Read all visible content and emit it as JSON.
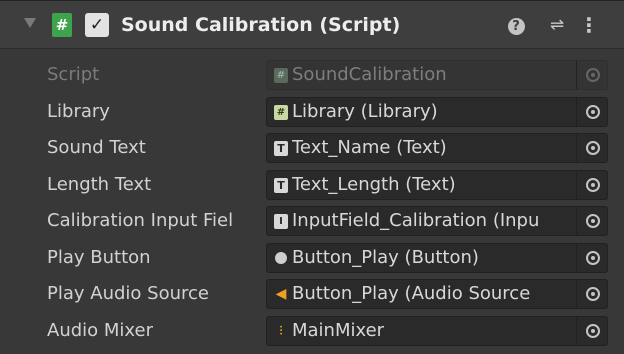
{
  "component": {
    "title": "Sound Calibration (Script)",
    "enabled": true,
    "script_icon_glyph": "#",
    "checkbox_glyph": "✓",
    "help_glyph": "?",
    "preset_glyph": "⇌",
    "menu_glyph": "⋮"
  },
  "fields": [
    {
      "label": "Script",
      "value": "SoundCalibration",
      "icon": "script-icon",
      "glyph": "#",
      "disabled": true
    },
    {
      "label": "Library",
      "value": "Library (Library)",
      "icon": "script-icon",
      "glyph": "#",
      "disabled": false
    },
    {
      "label": "Sound Text",
      "value": "Text_Name (Text)",
      "icon": "text-icon",
      "glyph": "T",
      "disabled": false
    },
    {
      "label": "Length Text",
      "value": "Text_Length (Text)",
      "icon": "text-icon",
      "glyph": "T",
      "disabled": false
    },
    {
      "label": "Calibration Input Fiel",
      "value": "InputField_Calibration (Inpu",
      "icon": "input-field-icon",
      "glyph": "I",
      "disabled": false
    },
    {
      "label": "Play Button",
      "value": "Button_Play (Button)",
      "icon": "button-icon",
      "glyph": "",
      "disabled": false
    },
    {
      "label": "Play Audio Source",
      "value": "Button_Play (Audio Source",
      "icon": "audio-source-icon",
      "glyph": "◀",
      "disabled": false
    },
    {
      "label": "Audio Mixer",
      "value": "MainMixer",
      "icon": "audio-mixer-icon",
      "glyph": "⫶",
      "disabled": false
    }
  ],
  "colors": {
    "background": "#383838",
    "header": "#3e3e3e",
    "field": "#2a2a2a",
    "script_green": "#3ea34d",
    "audio_orange": "#f0a020"
  }
}
